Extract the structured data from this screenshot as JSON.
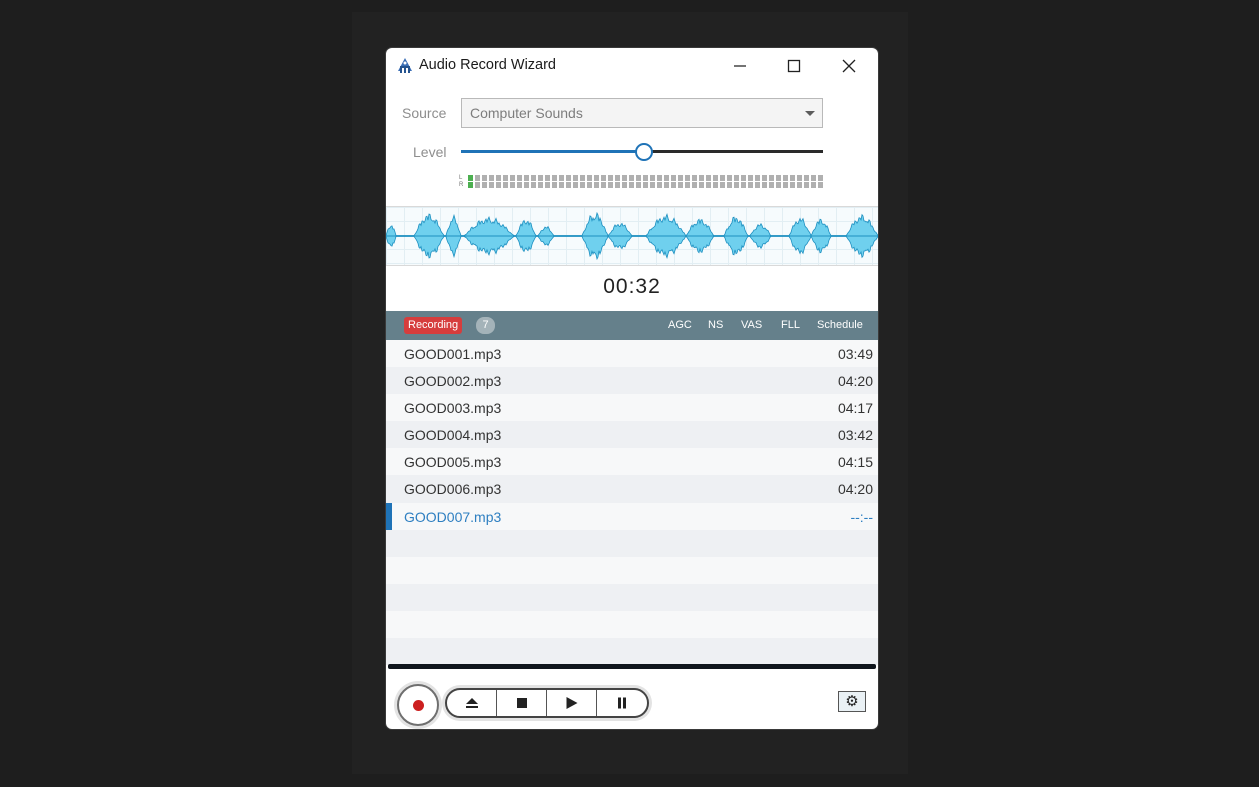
{
  "window": {
    "title": "Audio Record Wizard"
  },
  "form": {
    "source_label": "Source",
    "source_value": "Computer Sounds",
    "level_label": "Level",
    "level_value": 0.5,
    "meter_channels": [
      "L",
      "R"
    ]
  },
  "timer": "00:32",
  "list_header": {
    "status": "Recording",
    "count": "7",
    "columns": [
      "AGC",
      "NS",
      "VAS",
      "FLL",
      "Schedule"
    ]
  },
  "files": [
    {
      "name": "GOOD001.mp3",
      "duration": "03:49"
    },
    {
      "name": "GOOD002.mp3",
      "duration": "04:20"
    },
    {
      "name": "GOOD003.mp3",
      "duration": "04:17"
    },
    {
      "name": "GOOD004.mp3",
      "duration": "03:42"
    },
    {
      "name": "GOOD005.mp3",
      "duration": "04:15"
    },
    {
      "name": "GOOD006.mp3",
      "duration": "04:20"
    },
    {
      "name": "GOOD007.mp3",
      "duration": "--:--",
      "active": true
    }
  ],
  "controls": {
    "icons": [
      "record-icon",
      "eject-icon",
      "stop-icon",
      "play-icon",
      "pause-icon",
      "gear-icon"
    ]
  },
  "colors": {
    "accent": "#1f73b7",
    "recording": "#d63d3d",
    "header": "#65808b",
    "waveform": "#6fd0ee"
  }
}
